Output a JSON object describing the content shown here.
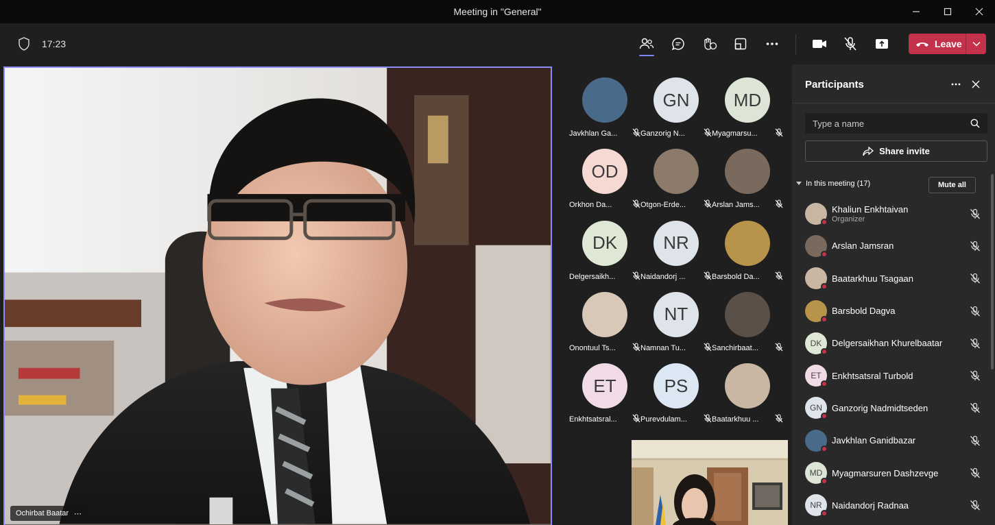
{
  "window": {
    "title": "Meeting in \"General\""
  },
  "toolbar": {
    "timer": "17:23",
    "leave_label": "Leave"
  },
  "main_speaker": {
    "name": "Ochirbat Baatar",
    "more": "⋯"
  },
  "grid": [
    {
      "label": "Javkhlan Ga...",
      "initials": "",
      "bg": "#4a6a8a"
    },
    {
      "label": "Ganzorig N...",
      "initials": "GN",
      "bg": "#dfe3ea"
    },
    {
      "label": "Myagmarsu...",
      "initials": "MD",
      "bg": "#dde5d6"
    },
    {
      "label": "Orkhon Da...",
      "initials": "OD",
      "bg": "#f7d9d4"
    },
    {
      "label": "Otgon-Erde...",
      "initials": "",
      "bg": "#8c7a6a"
    },
    {
      "label": "Arslan Jams...",
      "initials": "",
      "bg": "#7a6a5e"
    },
    {
      "label": "Delgersaikh...",
      "initials": "DK",
      "bg": "#dfe8d4"
    },
    {
      "label": "Naidandorj ...",
      "initials": "NR",
      "bg": "#dfe3ea"
    },
    {
      "label": "Barsbold Da...",
      "initials": "",
      "bg": "#b8944a"
    },
    {
      "label": "Onontuul Ts...",
      "initials": "",
      "bg": "#d8c8b8"
    },
    {
      "label": "Namnan Tu...",
      "initials": "NT",
      "bg": "#dfe3ea"
    },
    {
      "label": "Sanchirbaat...",
      "initials": "",
      "bg": "#5a5048"
    },
    {
      "label": "Enkhtsatsral...",
      "initials": "ET",
      "bg": "#f0dbe6"
    },
    {
      "label": "Purevdulam...",
      "initials": "PS",
      "bg": "#dbe7f2"
    },
    {
      "label": "Baatarkhuu ...",
      "initials": "",
      "bg": "#c9b7a4"
    }
  ],
  "panel": {
    "title": "Participants",
    "search_placeholder": "Type a name",
    "share_label": "Share invite",
    "section_label": "In this meeting (17)",
    "mute_all_label": "Mute all",
    "participants": [
      {
        "name": "Khaliun Enkhtaivan",
        "role": "Organizer",
        "initials": "",
        "bg": "#c7b6a2"
      },
      {
        "name": "Arslan Jamsran",
        "role": "",
        "initials": "",
        "bg": "#7a6a5e"
      },
      {
        "name": "Baatarkhuu Tsagaan",
        "role": "",
        "initials": "",
        "bg": "#c9b7a4"
      },
      {
        "name": "Barsbold Dagva",
        "role": "",
        "initials": "",
        "bg": "#b8944a"
      },
      {
        "name": "Delgersaikhan Khurelbaatar",
        "role": "",
        "initials": "DK",
        "bg": "#dfe8d4"
      },
      {
        "name": "Enkhtsatsral Turbold",
        "role": "",
        "initials": "ET",
        "bg": "#f0dbe6"
      },
      {
        "name": "Ganzorig Nadmidtseden",
        "role": "",
        "initials": "GN",
        "bg": "#dfe3ea"
      },
      {
        "name": "Javkhlan Ganidbazar",
        "role": "",
        "initials": "",
        "bg": "#4a6a8a"
      },
      {
        "name": "Myagmarsuren Dashzevge",
        "role": "",
        "initials": "MD",
        "bg": "#dde5d6"
      },
      {
        "name": "Naidandorj Radnaa",
        "role": "",
        "initials": "NR",
        "bg": "#dfe3ea"
      }
    ]
  },
  "colors": {
    "accent": "#7f85f5",
    "leave": "#c4314b",
    "panel": "#292929",
    "stage": "#1f1f1f"
  }
}
